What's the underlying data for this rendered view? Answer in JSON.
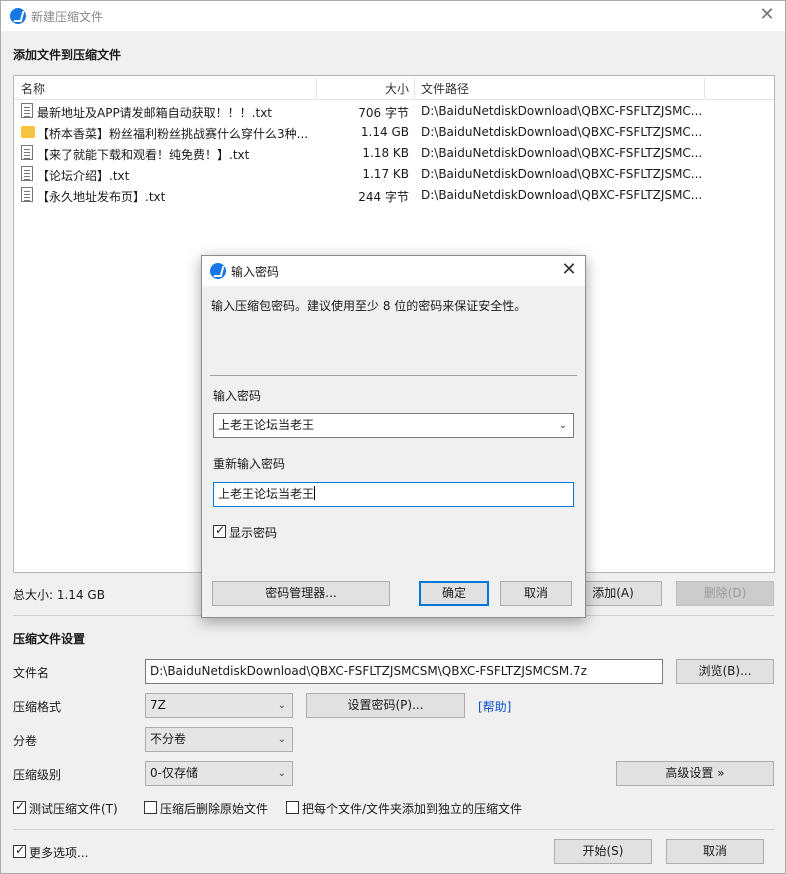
{
  "window": {
    "title": "新建压缩文件"
  },
  "add_section": {
    "title": "添加文件到压缩文件"
  },
  "file_list": {
    "columns": {
      "name": "名称",
      "size": "大小",
      "path": "文件路径"
    },
    "rows": [
      {
        "icon": "text-file-icon",
        "name": "最新地址及APP请发邮箱自动获取！！！.txt",
        "size": "706 字节",
        "path": "D:\\BaiduNetdiskDownload\\QBXC-FSFLTZJSMC..."
      },
      {
        "icon": "folder-icon",
        "name": "【桥本香菜】粉丝福利粉丝挑战赛什么穿什么3种...",
        "size": "1.14 GB",
        "path": "D:\\BaiduNetdiskDownload\\QBXC-FSFLTZJSMC..."
      },
      {
        "icon": "text-file-icon",
        "name": "【来了就能下载和观看！纯免费！】.txt",
        "size": "1.18 KB",
        "path": "D:\\BaiduNetdiskDownload\\QBXC-FSFLTZJSMC..."
      },
      {
        "icon": "text-file-icon",
        "name": "【论坛介绍】.txt",
        "size": "1.17 KB",
        "path": "D:\\BaiduNetdiskDownload\\QBXC-FSFLTZJSMC..."
      },
      {
        "icon": "text-file-icon",
        "name": "【永久地址发布页】.txt",
        "size": "244 字节",
        "path": "D:\\BaiduNetdiskDownload\\QBXC-FSFLTZJSMC..."
      }
    ]
  },
  "total_size": "总大小: 1.14 GB",
  "buttons": {
    "add": "添加(A)",
    "delete": "删除(D)"
  },
  "settings": {
    "title": "压缩文件设置",
    "filename_label": "文件名",
    "filename_value": "D:\\BaiduNetdiskDownload\\QBXC-FSFLTZJSMCSM\\QBXC-FSFLTZJSMCSM.7z",
    "browse": "浏览(B)...",
    "format_label": "压缩格式",
    "format_value": "7Z",
    "set_password": "设置密码(P)...",
    "help": "[帮助]",
    "volume_label": "分卷",
    "volume_value": "不分卷",
    "level_label": "压缩级别",
    "level_value": "0-仅存储",
    "advanced": "高级设置 »",
    "test_archive": "测试压缩文件(T)",
    "delete_after": "压缩后删除原始文件",
    "separate_archives": "把每个文件/文件夹添加到独立的压缩文件"
  },
  "footer": {
    "more_options": "更多选项...",
    "start": "开始(S)",
    "cancel": "取消"
  },
  "dialog": {
    "title": "输入密码",
    "description": "输入压缩包密码。建议使用至少 8 位的密码来保证安全性。",
    "password_label": "输入密码",
    "password_value": "上老王论坛当老王",
    "confirm_label": "重新输入密码",
    "confirm_value": "上老王论坛当老王",
    "show_password": "显示密码",
    "password_manager": "密码管理器...",
    "ok": "确定",
    "cancel": "取消"
  },
  "colors": {
    "accent": "#0078d7",
    "link": "#0b4fd1",
    "app_icon": "#1677e8"
  }
}
